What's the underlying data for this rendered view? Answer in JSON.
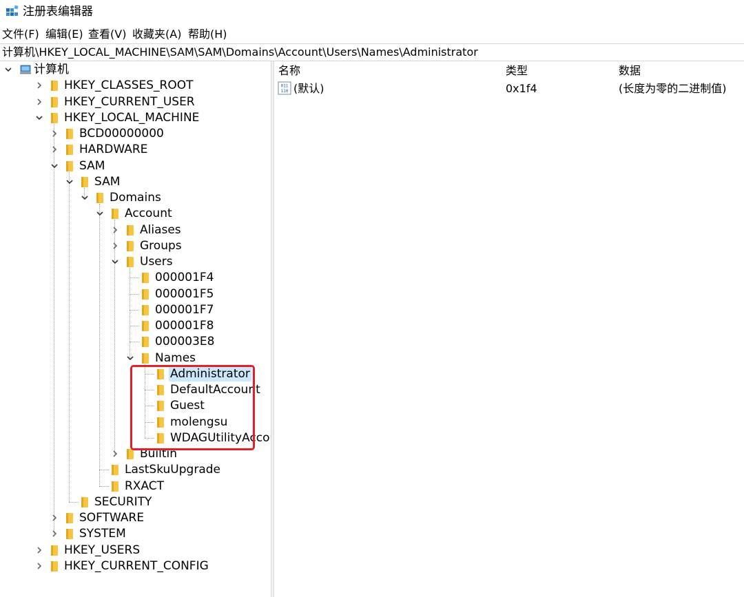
{
  "window": {
    "title": "注册表编辑器"
  },
  "menu": [
    "文件(F)",
    "编辑(E)",
    "查看(V)",
    "收藏夹(A)",
    "帮助(H)"
  ],
  "address": "计算机\\HKEY_LOCAL_MACHINE\\SAM\\SAM\\Domains\\Account\\Users\\Names\\Administrator",
  "tree": [
    {
      "label": "计算机",
      "expander": "expanded",
      "icon": "computer-icon"
    },
    {
      "label": "HKEY_CLASSES_ROOT",
      "expander": "collapsed"
    },
    {
      "label": "HKEY_CURRENT_USER",
      "expander": "collapsed"
    },
    {
      "label": "HKEY_LOCAL_MACHINE",
      "expander": "expanded"
    },
    {
      "label": "BCD00000000",
      "expander": "collapsed"
    },
    {
      "label": "HARDWARE",
      "expander": "collapsed"
    },
    {
      "label": "SAM",
      "expander": "expanded"
    },
    {
      "label": "SAM",
      "expander": "expanded"
    },
    {
      "label": "Domains",
      "expander": "expanded"
    },
    {
      "label": "Account",
      "expander": "expanded"
    },
    {
      "label": "Aliases",
      "expander": "collapsed"
    },
    {
      "label": "Groups",
      "expander": "collapsed"
    },
    {
      "label": "Users",
      "expander": "expanded"
    },
    {
      "label": "000001F4",
      "expander": "none"
    },
    {
      "label": "000001F5",
      "expander": "none"
    },
    {
      "label": "000001F7",
      "expander": "none"
    },
    {
      "label": "000001F8",
      "expander": "none"
    },
    {
      "label": "000003E8",
      "expander": "none"
    },
    {
      "label": "Names",
      "expander": "expanded"
    },
    {
      "label": "Administrator",
      "expander": "none",
      "selected": true
    },
    {
      "label": "DefaultAccount",
      "expander": "none"
    },
    {
      "label": "Guest",
      "expander": "none"
    },
    {
      "label": "molengsu",
      "expander": "none"
    },
    {
      "label": "WDAGUtilityAccount",
      "expander": "none"
    },
    {
      "label": "Builtin",
      "expander": "collapsed"
    },
    {
      "label": "LastSkuUpgrade",
      "expander": "none"
    },
    {
      "label": "RXACT",
      "expander": "none"
    },
    {
      "label": "SECURITY",
      "expander": "none"
    },
    {
      "label": "SOFTWARE",
      "expander": "collapsed"
    },
    {
      "label": "SYSTEM",
      "expander": "collapsed"
    },
    {
      "label": "HKEY_USERS",
      "expander": "collapsed"
    },
    {
      "label": "HKEY_CURRENT_CONFIG",
      "expander": "collapsed"
    }
  ],
  "list": {
    "columns": [
      "名称",
      "类型",
      "数据"
    ],
    "rows": [
      {
        "name": "(默认)",
        "type": "0x1f4",
        "data": "(长度为零的二进制值)",
        "icon": "binary-value-icon"
      }
    ]
  },
  "colors": {
    "folder": "#f6c543",
    "folder_dark": "#e2a820",
    "selection": "#cce8ff",
    "highlight_box": "#e0202a"
  }
}
